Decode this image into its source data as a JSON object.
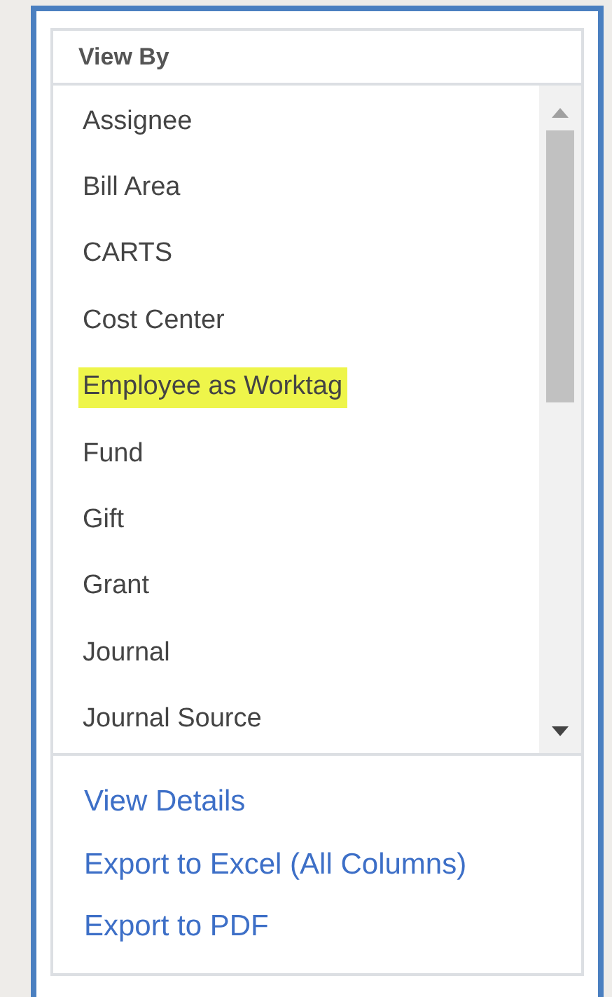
{
  "panel": {
    "title": "View By"
  },
  "items": [
    {
      "label": "Assignee",
      "highlighted": false
    },
    {
      "label": "Bill Area",
      "highlighted": false
    },
    {
      "label": "CARTS",
      "highlighted": false
    },
    {
      "label": "Cost Center",
      "highlighted": false
    },
    {
      "label": "Employee as Worktag",
      "highlighted": true
    },
    {
      "label": "Fund",
      "highlighted": false
    },
    {
      "label": "Gift",
      "highlighted": false
    },
    {
      "label": "Grant",
      "highlighted": false
    },
    {
      "label": "Journal",
      "highlighted": false
    },
    {
      "label": "Journal Source",
      "highlighted": false
    }
  ],
  "links": [
    "View Details",
    "Export to Excel (All Columns)",
    "Export to PDF"
  ]
}
